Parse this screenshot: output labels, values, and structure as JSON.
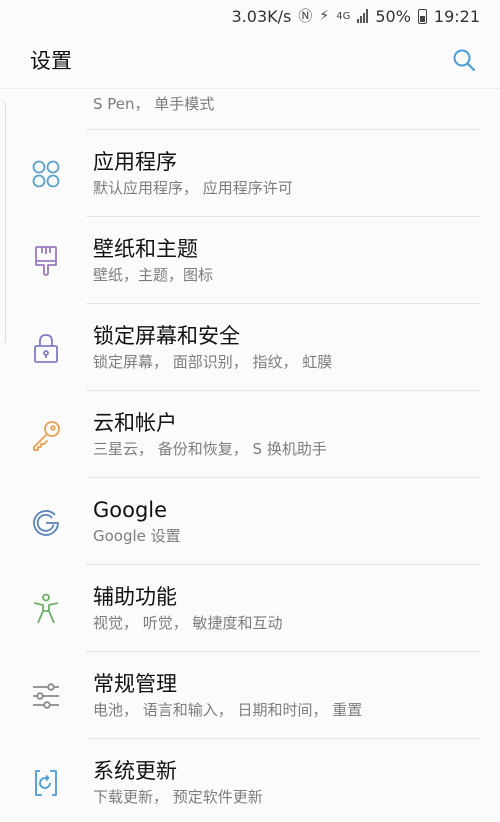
{
  "status_bar": {
    "speed": "3.03K/s",
    "battery": "50%",
    "time": "19:21",
    "network": "4G"
  },
  "header": {
    "title": "设置"
  },
  "rows": [
    {
      "title": "",
      "subtitle": "S Pen， 单手模式"
    },
    {
      "title": "应用程序",
      "subtitle": "默认应用程序， 应用程序许可"
    },
    {
      "title": "壁纸和主题",
      "subtitle": "壁纸，主题，图标"
    },
    {
      "title": "锁定屏幕和安全",
      "subtitle": "锁定屏幕， 面部识别， 指纹， 虹膜"
    },
    {
      "title": "云和帐户",
      "subtitle": "三星云， 备份和恢复， S 换机助手"
    },
    {
      "title": "Google",
      "subtitle": "Google 设置"
    },
    {
      "title": "辅助功能",
      "subtitle": "视觉， 听觉， 敏捷度和互动"
    },
    {
      "title": "常规管理",
      "subtitle": "电池， 语言和输入， 日期和时间， 重置"
    },
    {
      "title": "系统更新",
      "subtitle": "下载更新， 预定软件更新"
    }
  ],
  "icons": {
    "advanced": "gear-icon",
    "apps": "apps-grid-icon",
    "wallpaper": "paintbrush-icon",
    "lock": "lock-icon",
    "cloud": "key-icon",
    "google": "google-icon",
    "accessibility": "accessibility-icon",
    "general": "sliders-icon",
    "update": "update-icon"
  },
  "colors": {
    "accent": "#4a9bd1",
    "apps": "#5aa0c8",
    "wallpaper": "#9b79c0",
    "lock": "#7f7fc4",
    "cloud": "#e6a052",
    "google": "#5a84b8",
    "accessibility": "#6db06a",
    "general": "#8a8a8a",
    "update": "#4a9bd1"
  }
}
